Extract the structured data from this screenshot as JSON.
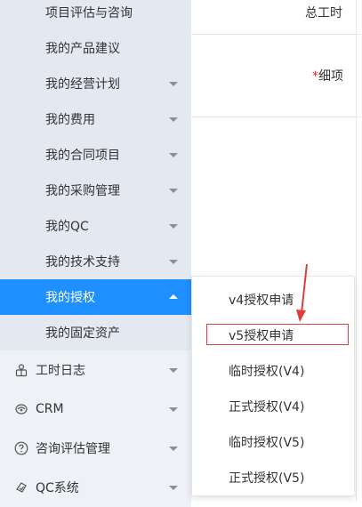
{
  "sidebar": {
    "sub_items": [
      {
        "label": "项目评估与咨询",
        "has_caret": false,
        "active": false
      },
      {
        "label": "我的产品建议",
        "has_caret": false,
        "active": false
      },
      {
        "label": "我的经营计划",
        "has_caret": true,
        "active": false
      },
      {
        "label": "我的费用",
        "has_caret": true,
        "active": false
      },
      {
        "label": "我的合同项目",
        "has_caret": true,
        "active": false
      },
      {
        "label": "我的采购管理",
        "has_caret": true,
        "active": false
      },
      {
        "label": "我的QC",
        "has_caret": true,
        "active": false
      },
      {
        "label": "我的技术支持",
        "has_caret": true,
        "active": false
      },
      {
        "label": "我的授权",
        "has_caret": true,
        "active": true
      },
      {
        "label": "我的固定资产",
        "has_caret": false,
        "active": false
      }
    ],
    "main_items": [
      {
        "label": "工时日志",
        "icon": "clock-icon"
      },
      {
        "label": "CRM",
        "icon": "crm-icon"
      },
      {
        "label": "咨询评估管理",
        "icon": "question-circle-icon"
      },
      {
        "label": "QC系统",
        "icon": "shield-check-icon"
      }
    ]
  },
  "form": {
    "total_hours_label": "总工时",
    "detail_required_mark": "*",
    "detail_label": "细项"
  },
  "popup_menu": {
    "items": [
      {
        "label": "v4授权申请"
      },
      {
        "label": "v5授权申请",
        "highlighted": true
      },
      {
        "label": "临时授权(V4)"
      },
      {
        "label": "正式授权(V4)"
      },
      {
        "label": "临时授权(V5)"
      },
      {
        "label": "正式授权(V5)"
      }
    ]
  },
  "colors": {
    "active_bg": "#1e90ff",
    "sidebar_bg": "#eef1f6",
    "submenu_bg": "#e4e8f1",
    "highlight_border": "#e03c3c"
  }
}
